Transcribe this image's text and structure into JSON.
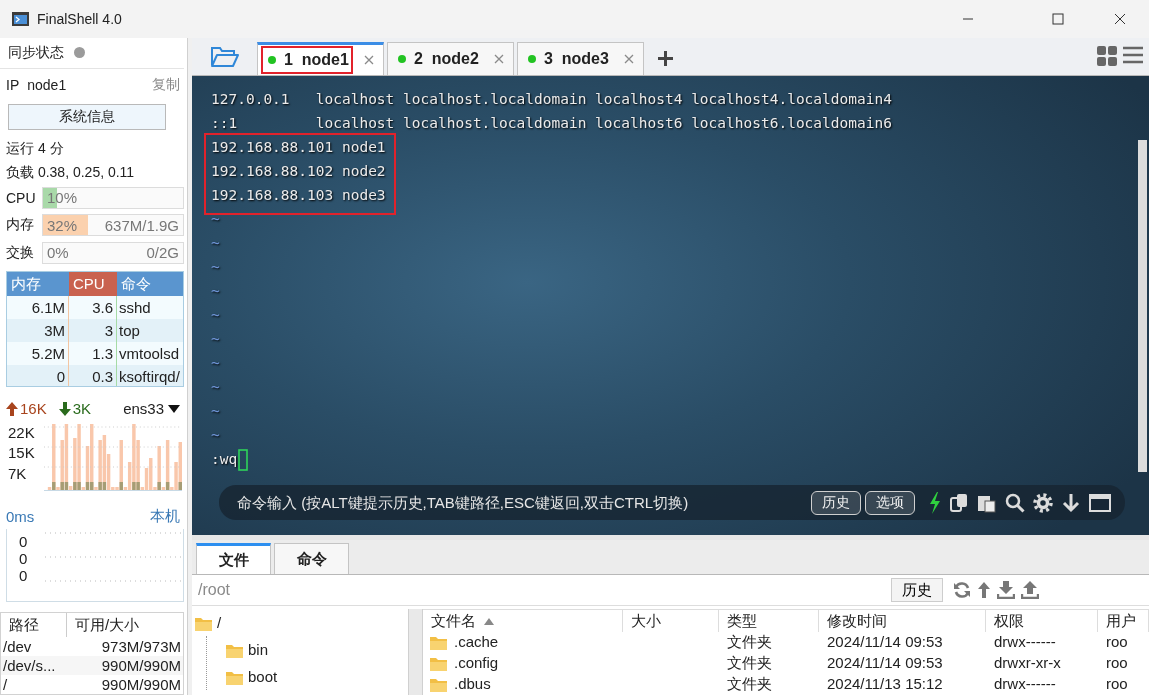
{
  "window": {
    "title": "FinalShell 4.0"
  },
  "sidebar": {
    "sync_label": "同步状态",
    "synced": false,
    "ip_label": "IP",
    "host": "node1",
    "copy_link": "复制",
    "info_button": "系统信息",
    "uptime": "运行 4 分",
    "load": "负载 0.38, 0.25, 0.11",
    "meters": [
      {
        "label": "CPU",
        "level": 0.1,
        "percent": "10%",
        "color": "#a9d9a9"
      },
      {
        "label": "内存",
        "level": 0.32,
        "percent": "32%",
        "amount": "637M/1.9G",
        "color": "#fbd1ae"
      },
      {
        "label": "交换",
        "level": 0,
        "percent": "0%",
        "amount": "0/2G"
      }
    ],
    "processes": {
      "columns": [
        {
          "label": "内存",
          "sorted": false
        },
        {
          "label": "CPU",
          "sorted": true
        },
        {
          "label": "命令",
          "sorted": false
        }
      ],
      "rows": [
        [
          "6.1M",
          "3.6",
          "sshd"
        ],
        [
          "3M",
          "3",
          "top"
        ],
        [
          "5.2M",
          "1.3",
          "vmtoolsd"
        ],
        [
          "0",
          "0.3",
          "ksoftirqd/"
        ]
      ]
    },
    "network": {
      "up": "16K",
      "down": "3K",
      "interface": "ens33",
      "y_labels": [
        "22K",
        "15K",
        "7K"
      ]
    },
    "ping": {
      "latency": "0ms",
      "target": "本机",
      "y_labels": [
        "0",
        "0",
        "0"
      ]
    },
    "disks": {
      "columns": [
        "路径",
        "可用/大小"
      ],
      "rows": [
        [
          "/dev",
          "973M/973M"
        ],
        [
          "/dev/s...",
          "990M/990M"
        ],
        [
          "/",
          "990M/990M"
        ]
      ]
    }
  },
  "tabs": [
    {
      "label": "1  node1",
      "connected": true,
      "selected": true,
      "highlighted": true
    },
    {
      "label": "2  node2",
      "connected": true,
      "selected": false,
      "highlighted": false
    },
    {
      "label": "3  node3",
      "connected": true,
      "selected": false,
      "highlighted": false
    }
  ],
  "terminal": {
    "blocks": [
      {
        "kind": "text",
        "highlighted": false,
        "lines": [
          "127.0.0.1   localhost localhost.localdomain localhost4 localhost4.localdomain4",
          "::1         localhost localhost.localdomain localhost6 localhost6.localdomain6"
        ]
      },
      {
        "kind": "text",
        "highlighted": true,
        "lines": [
          "192.168.88.101 node1",
          "192.168.88.102 node2",
          "192.168.88.103 node3"
        ]
      },
      {
        "kind": "tilde",
        "highlighted": false,
        "lines": [
          "~",
          "~",
          "~",
          "~",
          "~",
          "~",
          "~",
          "~",
          "~",
          "~"
        ]
      }
    ],
    "prompt": ":wq",
    "command_bar": {
      "placeholder": "命令输入 (按ALT键提示历史,TAB键路径,ESC键返回,双击CTRL切换)",
      "buttons": [
        "历史",
        "选项"
      ]
    }
  },
  "files": {
    "tabs": [
      {
        "label": "文件",
        "selected": true
      },
      {
        "label": "命令",
        "selected": false
      }
    ],
    "path": "/root",
    "history_button": "历史",
    "tree": [
      {
        "name": "/",
        "children": [
          {
            "name": "bin"
          },
          {
            "name": "boot"
          }
        ]
      }
    ],
    "columns": [
      {
        "label": "文件名",
        "sorted": true
      },
      {
        "label": "大小",
        "sorted": false
      },
      {
        "label": "类型",
        "sorted": false
      },
      {
        "label": "修改时间",
        "sorted": false
      },
      {
        "label": "权限",
        "sorted": false
      },
      {
        "label": "用户",
        "sorted": false
      }
    ],
    "rows": [
      {
        "name": ".cache",
        "type": "文件夹",
        "modified": "2024/11/14 09:53",
        "permissions": "drwx------",
        "owner": "roo"
      },
      {
        "name": ".config",
        "type": "文件夹",
        "modified": "2024/11/14 09:53",
        "permissions": "drwxr-xr-x",
        "owner": "roo"
      },
      {
        "name": ".dbus",
        "type": "文件夹",
        "modified": "2024/11/13 15:12",
        "permissions": "drwx------",
        "owner": "roo"
      }
    ]
  }
}
